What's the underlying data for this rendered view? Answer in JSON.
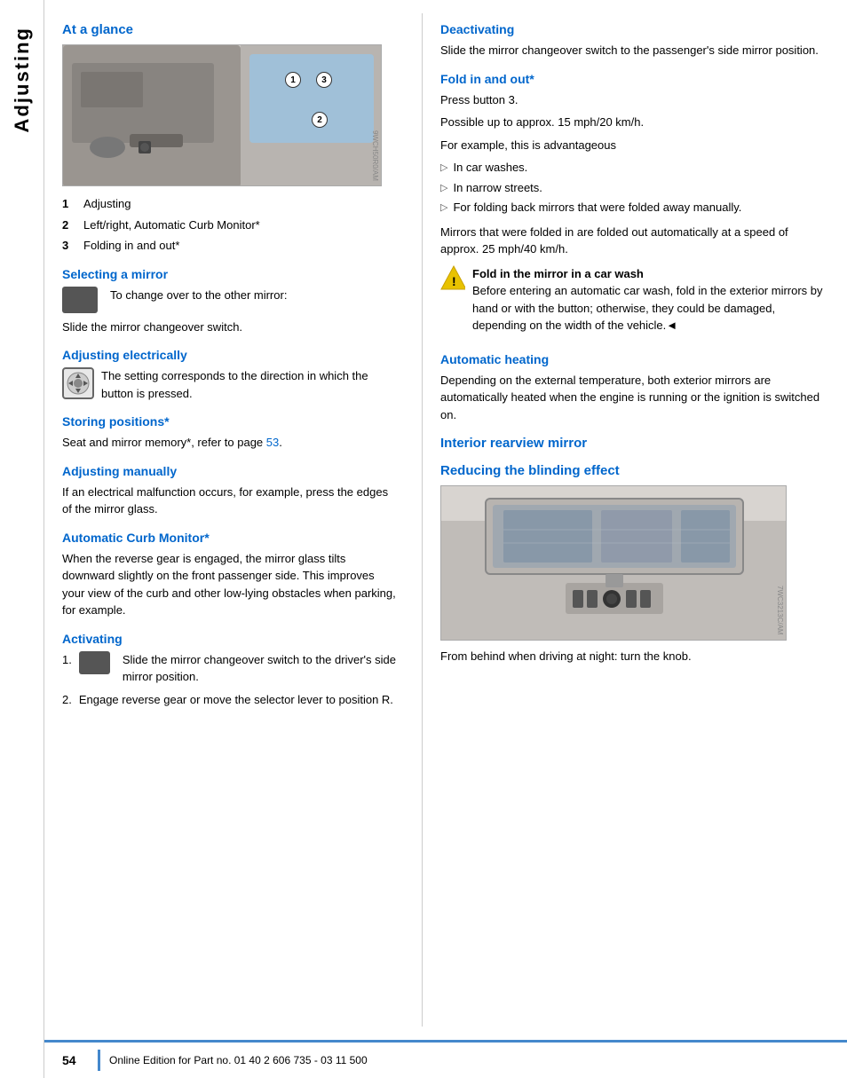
{
  "sidebar": {
    "label": "Adjusting"
  },
  "header": {
    "title": "At a glance"
  },
  "top_image": {
    "watermark": "9WCH50R0/AM",
    "badge1": "1",
    "badge2": "2",
    "badge3": "3"
  },
  "numbered_items": [
    {
      "num": "1",
      "text": "Adjusting"
    },
    {
      "num": "2",
      "text": "Left/right, Automatic Curb Monitor*"
    },
    {
      "num": "3",
      "text": "Folding in and out*"
    }
  ],
  "sections": {
    "selecting_mirror": {
      "title": "Selecting a mirror",
      "icon_text": "To change over to the other mirror:",
      "body": "Slide the mirror changeover switch."
    },
    "adjusting_electrically": {
      "title": "Adjusting electrically",
      "body": "The setting corresponds to the direction in which the button is pressed."
    },
    "storing_positions": {
      "title": "Storing positions*",
      "body": "Seat and mirror memory*, refer to page ",
      "page_link": "53",
      "body_suffix": "."
    },
    "adjusting_manually": {
      "title": "Adjusting manually",
      "body": "If an electrical malfunction occurs, for example, press the edges of the mirror glass."
    },
    "automatic_curb_monitor": {
      "title": "Automatic Curb Monitor*",
      "body": "When the reverse gear is engaged, the mirror glass tilts downward slightly on the front passenger side. This improves your view of the curb and other low-lying obstacles when parking, for example."
    },
    "activating": {
      "title": "Activating",
      "steps": [
        {
          "num": "1.",
          "has_icon": true,
          "text": "Slide the mirror changeover switch to the driver's side mirror position."
        },
        {
          "num": "2.",
          "has_icon": false,
          "text": "Engage reverse gear or move the selector lever to position R."
        }
      ]
    },
    "deactivating": {
      "title": "Deactivating",
      "body": "Slide the mirror changeover switch to the passenger's side mirror position."
    },
    "fold_in_out": {
      "title": "Fold in and out*",
      "body1": "Press button 3.",
      "body2": "Possible up to approx. 15 mph/20 km/h.",
      "body3": "For example, this is advantageous",
      "bullets": [
        "In car washes.",
        "In narrow streets.",
        "For folding back mirrors that were folded away manually."
      ],
      "body4": "Mirrors that were folded in are folded out automatically at a speed of approx. 25 mph/40 km/h."
    },
    "warning": {
      "title": "Fold in the mirror in a car wash",
      "body": "Before entering an automatic car wash, fold in the exterior mirrors by hand or with the button; otherwise, they could be damaged, depending on the width of the vehicle.◄"
    },
    "automatic_heating": {
      "title": "Automatic heating",
      "body": "Depending on the external temperature, both exterior mirrors are automatically heated when the engine is running or the ignition is switched on."
    },
    "interior_rearview_mirror": {
      "title": "Interior rearview mirror"
    },
    "reducing_blinding_effect": {
      "title": "Reducing the blinding effect",
      "bottom_image_watermark": "7WC3213C/AM",
      "body": "From behind when driving at night: turn the knob."
    }
  },
  "footer": {
    "page_number": "54",
    "text": "Online Edition for Part no. 01 40 2 606 735 - 03 11 500"
  }
}
